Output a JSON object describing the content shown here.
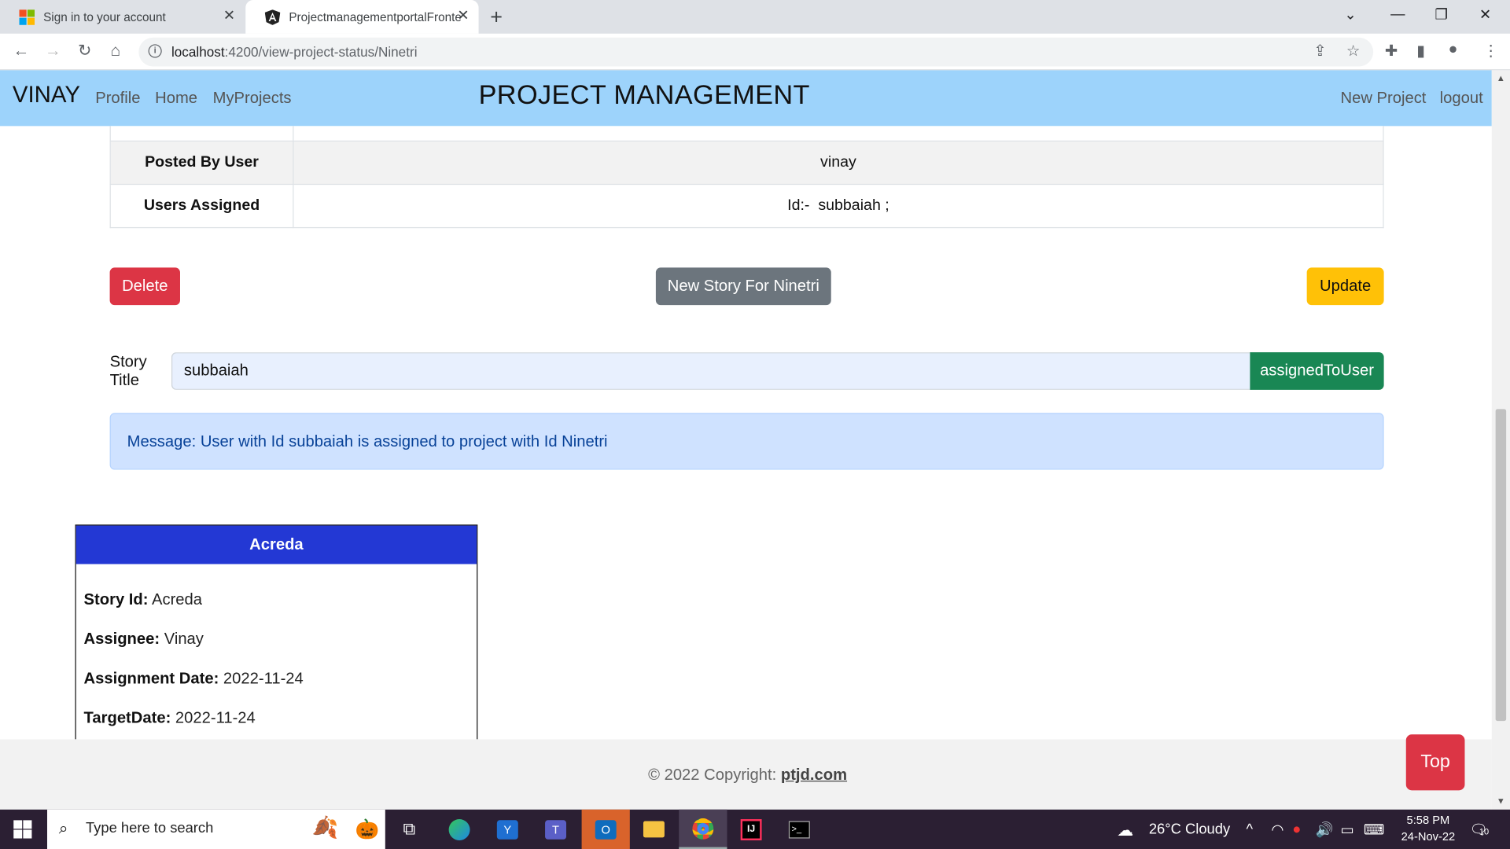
{
  "browser": {
    "tabs": [
      {
        "title": "Sign in to your account"
      },
      {
        "title": "ProjectmanagementportalFronte"
      }
    ],
    "url_host": "localhost",
    "url_path": ":4200/view-project-status/Ninetri"
  },
  "navbar": {
    "brand": "VINAY",
    "links": [
      "Profile",
      "Home",
      "MyProjects"
    ],
    "title": "PROJECT MANAGEMENT",
    "right_links": [
      "New Project",
      "logout"
    ]
  },
  "details": {
    "rows": [
      {
        "label": "Posted By User",
        "value": "vinay"
      },
      {
        "label": "Users Assigned",
        "value": "Id:-  subbaiah ;"
      }
    ]
  },
  "actions": {
    "delete": "Delete",
    "new_story": "New Story For Ninetri",
    "update": "Update"
  },
  "story_form": {
    "label_line1": "Story",
    "label_line2": "Title",
    "value": "subbaiah",
    "button": "assignedToUser"
  },
  "alert": {
    "message": "Message: User with Id subbaiah is assigned to project with Id Ninetri"
  },
  "story_card": {
    "header": "Acreda",
    "fields": [
      {
        "label": "Story Id:",
        "value": "Acreda"
      },
      {
        "label": "Assignee:",
        "value": "Vinay"
      },
      {
        "label": "Assignment Date:",
        "value": "2022-11-24"
      },
      {
        "label": "TargetDate:",
        "value": "2022-11-24"
      }
    ]
  },
  "footer": {
    "copyright": "© 2022 Copyright:",
    "link": "ptjd.com",
    "top_button": "Top"
  },
  "taskbar": {
    "search_placeholder": "Type here to search",
    "weather": "26°C  Cloudy",
    "time": "5:58 PM",
    "date": "24-Nov-22",
    "notification_count": "10"
  },
  "colors": {
    "navbar": "#9dd3fb",
    "danger": "#dc3545",
    "secondary": "#6c757d",
    "warning": "#ffc107",
    "success": "#198754",
    "card_header": "#2338d4",
    "alert_bg": "#cfe2ff"
  }
}
